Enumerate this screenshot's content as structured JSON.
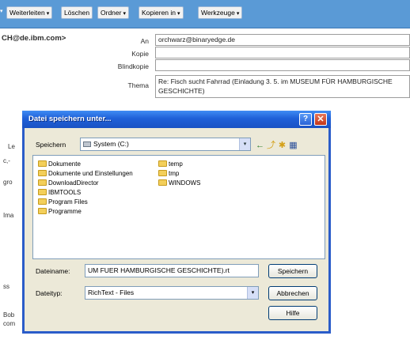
{
  "toolbar": {
    "lead": "▾",
    "buttons": [
      {
        "label": "Weiterleiten",
        "caret": "▾"
      },
      {
        "label": "Löschen"
      },
      {
        "label": "Ordner",
        "caret": "▾"
      },
      {
        "label": "Kopieren in",
        "caret": "▾"
      },
      {
        "label": "Werkzeuge",
        "caret": "▾"
      }
    ]
  },
  "mail": {
    "sender": "CH@de.ibm.com>",
    "labels": {
      "an": "An",
      "kopie": "Kopie",
      "blindkopie": "Blindkopie",
      "thema": "Thema"
    },
    "values": {
      "an": "orchwarz@binaryedge.de",
      "kopie": "",
      "blindkopie": "",
      "thema": "Re: Fisch sucht Fahrrad (Einladung 3. 5. im MUSEUM FÜR HAMBURGISCHE GESCHICHTE)"
    }
  },
  "background_fragments": [
    "Le",
    "c,-",
    "gro",
    "Ima",
    "ss",
    "Bob",
    "com"
  ],
  "dialog": {
    "title": "Datei speichern unter...",
    "help": "?",
    "close": "✕",
    "save_in_label": "Speichern",
    "save_in_value": "System (C:)",
    "dropdown_glyph": "▾",
    "nav_icons": [
      "←",
      "⤴",
      "✱",
      "▦"
    ],
    "folders_col1": [
      "Dokumente",
      "Dokumente und Einstellungen",
      "DownloadDirector",
      "IBMTOOLS",
      "Program Files",
      "Programme"
    ],
    "folders_col2": [
      "temp",
      "tmp",
      "WINDOWS"
    ],
    "filename_label": "Dateiname:",
    "filename_value": "UM FUER HAMBURGISCHE GESCHICHTE).rt",
    "filetype_label": "Dateityp:",
    "filetype_value": "RichText - Files",
    "buttons": {
      "save": "Speichern",
      "cancel": "Abbrechen",
      "help": "Hilfe"
    }
  },
  "colors": {
    "toolbar_bg": "#5a9ad6",
    "dialog_title": "#1f60d8",
    "dialog_bg": "#ece9d8"
  }
}
